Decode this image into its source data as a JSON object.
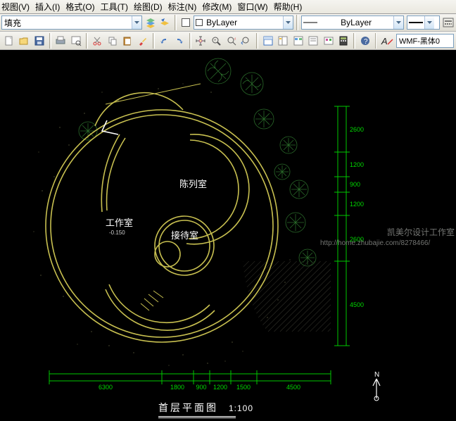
{
  "menu": {
    "view": "视图(V)",
    "insert": "插入(I)",
    "format": "格式(O)",
    "tools": "工具(T)",
    "draw": "绘图(D)",
    "dim": "标注(N)",
    "modify": "修改(M)",
    "window": "窗口(W)",
    "help": "帮助(H)"
  },
  "propbar": {
    "layer_combo": "填充",
    "linetype_combo": "ByLayer",
    "lineweight_combo": "ByLayer"
  },
  "toolbar": {
    "font_combo": "WMF-黑体0"
  },
  "drawing": {
    "room1": "工作室",
    "room2": "陈列室",
    "room3": "接待室",
    "title": "首层平面图",
    "scale": "1:100",
    "compass": "N",
    "small_lbl1": "-0.150",
    "dims_vertical": [
      "2600",
      "1200",
      "900",
      "1200",
      "2600",
      "4500"
    ],
    "dims_horizontal": [
      "6300",
      "1800",
      "900",
      "1200",
      "1500",
      "4500"
    ]
  },
  "watermark": {
    "line1": "凯美尔设计工作室",
    "line2": "http://home.zhubajie.com/8278466/"
  }
}
